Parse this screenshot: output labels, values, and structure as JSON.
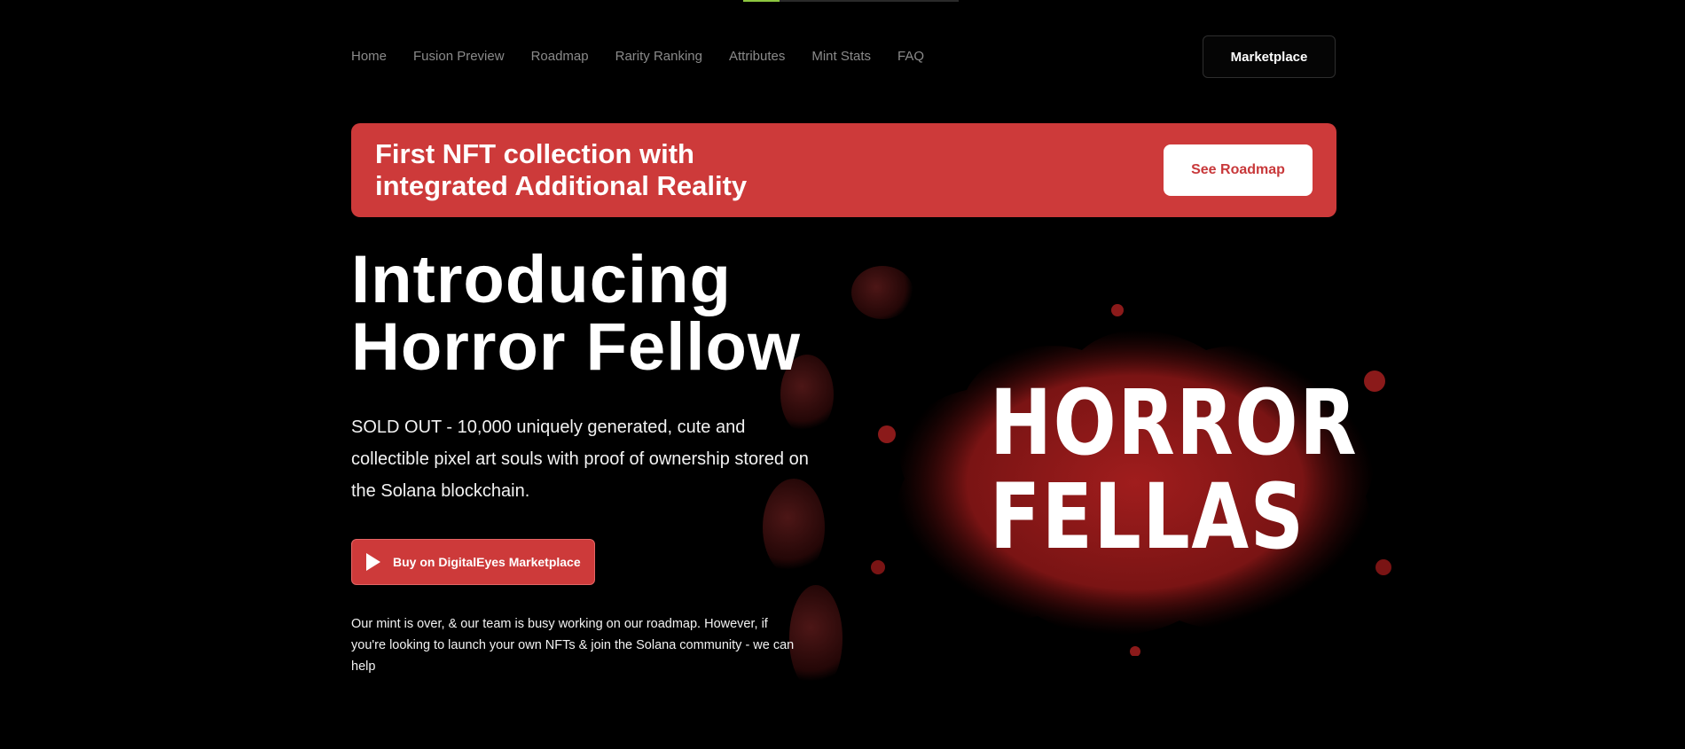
{
  "page": {
    "accent_color": "#cd3a3a",
    "background_color": "#000000",
    "scroll_progress": 0.17
  },
  "nav": {
    "items": [
      {
        "label": "Home"
      },
      {
        "label": "Fusion Preview"
      },
      {
        "label": "Roadmap"
      },
      {
        "label": "Rarity Ranking"
      },
      {
        "label": "Attributes"
      },
      {
        "label": "Mint Stats"
      },
      {
        "label": "FAQ"
      }
    ],
    "marketplace_label": "Marketplace"
  },
  "banner": {
    "line1": "First NFT collection with",
    "line2": "integrated Additional Reality",
    "button_label": "See Roadmap"
  },
  "hero": {
    "title_line1": "Introducing",
    "title_line2": "Horror Fellow",
    "description": "SOLD OUT - 10,000 uniquely generated, cute and collectible pixel art souls with proof of ownership stored on the Solana blockchain.",
    "buy_button_label": "Buy on DigitalEyes Marketplace",
    "buy_button_icon": "play-icon",
    "mint_note": "Our mint is over, & our team is busy working on our roadmap. However, if you're looking to launch your own NFTs & join the Solana community - we can help"
  },
  "art": {
    "logo_line1": "HORROR",
    "logo_line2": "FELLAS",
    "splatter_color": "#8b1a1a"
  }
}
